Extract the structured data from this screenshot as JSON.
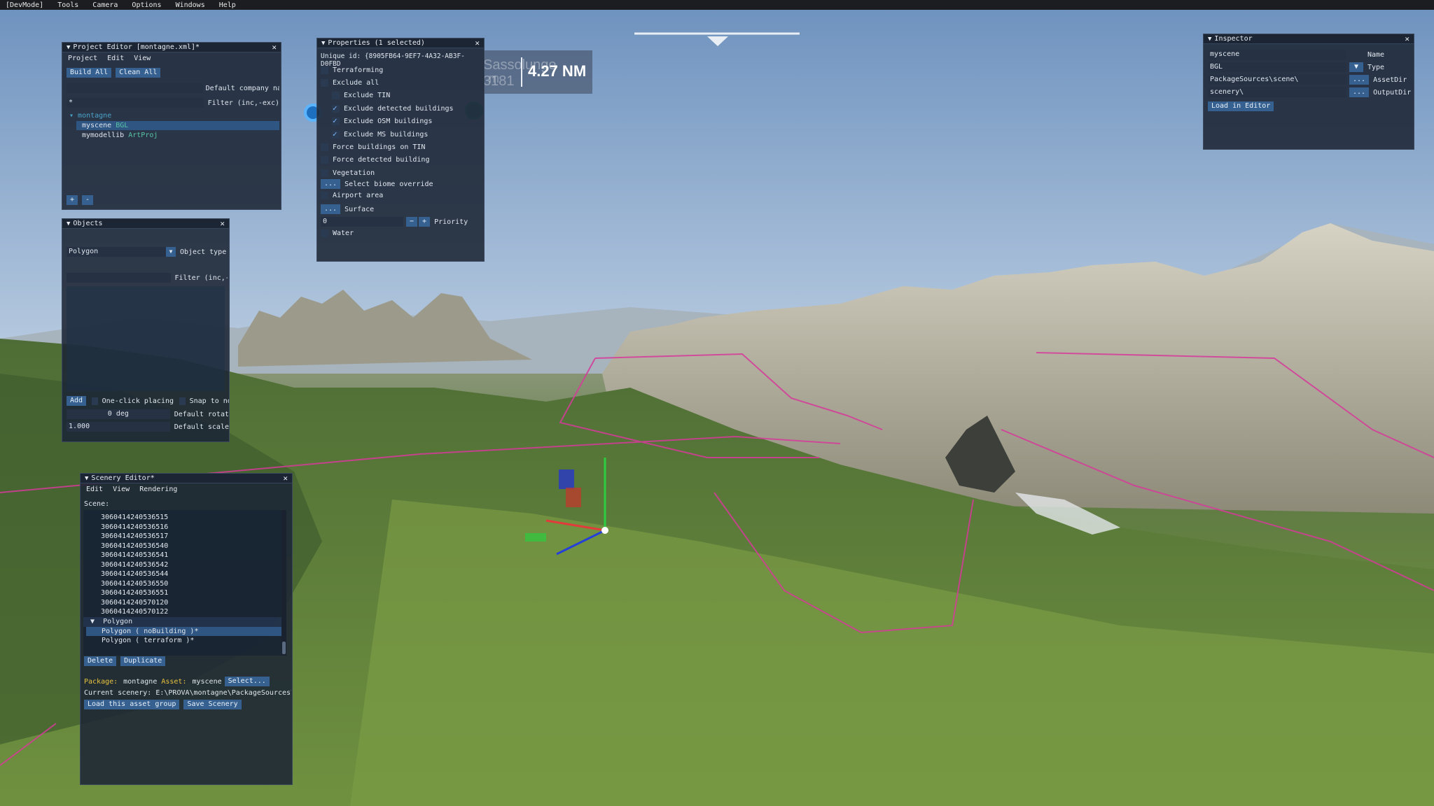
{
  "menubar": {
    "items": [
      "[DevMode]",
      "Tools",
      "Camera",
      "Options",
      "Windows",
      "Help"
    ]
  },
  "hud": {
    "distance": "4.27 NM",
    "ghost_title": "Sassolungo 3181",
    "ghost_sub": "m"
  },
  "project_editor": {
    "title": "Project Editor [montagne.xml]*",
    "menu": [
      "Project",
      "Edit",
      "View"
    ],
    "build_all": "Build All",
    "clean_all": "Clean All",
    "company_label": "Default company na",
    "filter_label": "Filter (inc,-exc)",
    "filter_value": "*",
    "tree_root": "montagne",
    "tree_items": [
      {
        "name": "myscene",
        "tag": "BGL"
      },
      {
        "name": "mymodellib",
        "tag": "ArtProj"
      }
    ],
    "add_btn": "+",
    "remove_btn": "-"
  },
  "objects": {
    "title": "Objects",
    "object_type_value": "Polygon",
    "object_type_label": "Object type",
    "filter_label": "Filter (inc,-",
    "add_btn": "Add",
    "one_click_label": "One-click placing",
    "snap_label": "Snap to norm",
    "rotation_value": "0",
    "rotation_unit": "deg",
    "rotation_label": "Default rotat",
    "scale_value": "1.000",
    "scale_label": "Default scale"
  },
  "properties": {
    "title": "Properties (1 selected)",
    "unique_id": "Unique id: {8905FB64-9EF7-4A32-AB3F-D0FBD",
    "options": [
      {
        "label": "Terraforming",
        "checked": false,
        "indent": 0
      },
      {
        "label": "Exclude all",
        "checked": false,
        "indent": 0
      },
      {
        "label": "Exclude TIN",
        "checked": false,
        "indent": 1
      },
      {
        "label": "Exclude detected buildings",
        "checked": true,
        "indent": 1
      },
      {
        "label": "Exclude OSM buildings",
        "checked": true,
        "indent": 1
      },
      {
        "label": "Exclude MS buildings",
        "checked": true,
        "indent": 1
      },
      {
        "label": "Force buildings on TIN",
        "checked": false,
        "indent": 0
      },
      {
        "label": "Force detected building",
        "checked": false,
        "indent": 0
      },
      {
        "label": "Vegetation",
        "checked": false,
        "indent": 0
      }
    ],
    "biome_btn": "...",
    "biome_label": "Select biome override",
    "airport_label": "Airport area",
    "surface_btn": "...",
    "surface_label": "Surface",
    "priority_value": "0",
    "priority_label": "Priority",
    "water_label": "Water"
  },
  "inspector": {
    "title": "Inspector",
    "rows": [
      {
        "value": "myscene",
        "label": "Name",
        "button": ""
      },
      {
        "value": "BGL",
        "label": "Type",
        "button": "▼"
      },
      {
        "value": "PackageSources\\scene\\",
        "label": "AssetDir",
        "button": "..."
      },
      {
        "value": "scenery\\",
        "label": "OutputDir",
        "button": "..."
      }
    ],
    "load_btn": "Load in Editor"
  },
  "scenery_editor": {
    "title": "Scenery Editor*",
    "menu": [
      "Edit",
      "View",
      "Rendering"
    ],
    "scene_label": "Scene:",
    "ids": [
      "3060414240536515",
      "3060414240536516",
      "3060414240536517",
      "3060414240536540",
      "3060414240536541",
      "3060414240536542",
      "3060414240536544",
      "3060414240536550",
      "3060414240536551",
      "3060414240570120",
      "3060414240570122"
    ],
    "group": "Polygon",
    "group_items": [
      "Polygon  ( noBuilding )*",
      "Polygon  ( terraform )*"
    ],
    "delete_btn": "Delete",
    "duplicate_btn": "Duplicate",
    "package_label": "Package:",
    "package_value": "montagne",
    "asset_label": "Asset:",
    "asset_value": "myscene",
    "select_btn": "Select...",
    "current_scenery": "Current scenery: E:\\PROVA\\montagne\\PackageSources\\sce",
    "load_group_btn": "Load this asset group",
    "save_btn": "Save Scenery"
  }
}
